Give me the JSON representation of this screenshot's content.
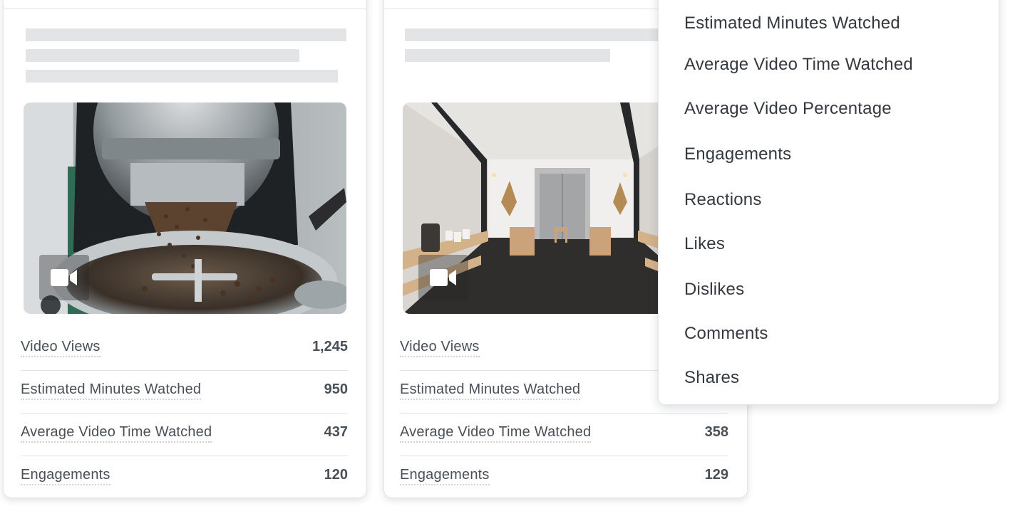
{
  "cards": [
    {
      "media": {
        "type": "video",
        "subject": "coffee roaster",
        "badge_icon": "video-camera-icon"
      },
      "metrics": [
        {
          "label": "Video Views",
          "value": "1,245"
        },
        {
          "label": "Estimated Minutes Watched",
          "value": "950"
        },
        {
          "label": "Average Video Time Watched",
          "value": "437"
        },
        {
          "label": "Engagements",
          "value": "120"
        }
      ]
    },
    {
      "media": {
        "type": "video",
        "subject": "cafe interior",
        "badge_icon": "video-camera-icon"
      },
      "metrics": [
        {
          "label": "Video Views",
          "value": ""
        },
        {
          "label": "Estimated Minutes Watched",
          "value": ""
        },
        {
          "label": "Average Video Time Watched",
          "value": "358"
        },
        {
          "label": "Engagements",
          "value": "129"
        }
      ]
    }
  ],
  "dropdown": {
    "items": [
      "Estimated Minutes Watched",
      "Average Video Time Watched",
      "Average Video Percentage",
      "Engagements",
      "Reactions",
      "Likes",
      "Dislikes",
      "Comments",
      "Shares"
    ]
  },
  "colors": {
    "skeleton": "#e2e4e6",
    "divider": "#e1e4e7",
    "text": "#4a5057"
  }
}
